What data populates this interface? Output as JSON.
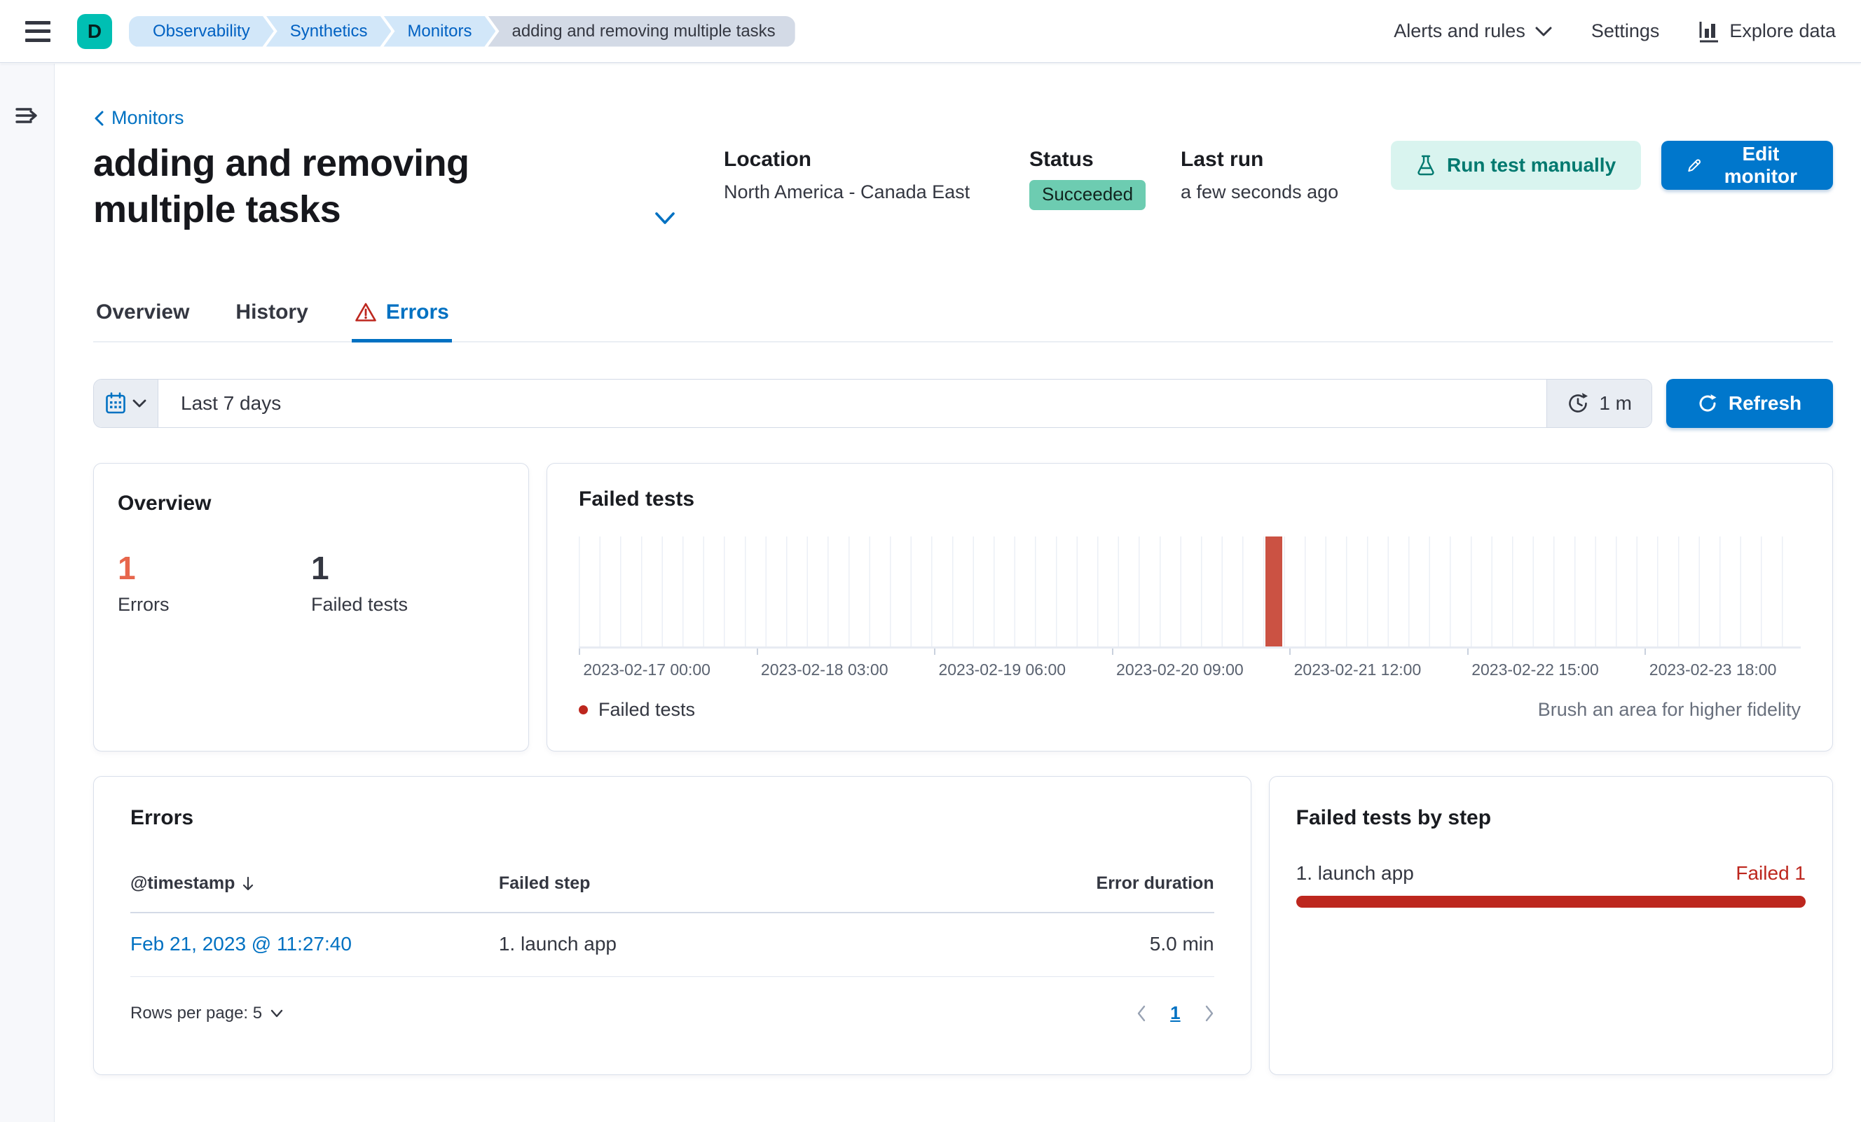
{
  "top_nav": {
    "logo_letter": "D",
    "breadcrumbs": [
      {
        "label": "Observability"
      },
      {
        "label": "Synthetics"
      },
      {
        "label": "Monitors"
      },
      {
        "label": "adding and removing multiple tasks"
      }
    ],
    "alerts_menu_label": "Alerts and rules",
    "settings_label": "Settings",
    "explore_data_label": "Explore data"
  },
  "header": {
    "back_link": "Monitors",
    "title": "adding and removing multiple tasks",
    "location_label": "Location",
    "location_value": "North America - Canada East",
    "status_label": "Status",
    "status_value": "Succeeded",
    "last_run_label": "Last run",
    "last_run_value": "a few seconds ago",
    "run_test_button": "Run test manually",
    "edit_button": "Edit monitor"
  },
  "tabs": [
    {
      "label": "Overview"
    },
    {
      "label": "History"
    },
    {
      "label": "Errors",
      "active": true
    }
  ],
  "toolbar": {
    "time_range": "Last 7 days",
    "refresh_interval": "1 m",
    "refresh_label": "Refresh"
  },
  "overview_panel": {
    "title": "Overview",
    "stats": [
      {
        "value": "1",
        "label": "Errors",
        "color": "#E7664C"
      },
      {
        "value": "1",
        "label": "Failed tests",
        "color": "#343741"
      }
    ]
  },
  "failed_tests_panel": {
    "title": "Failed tests",
    "legend": "Failed tests",
    "note": "Brush an area for higher fidelity"
  },
  "chart_data": {
    "type": "bar",
    "title": "Failed tests",
    "x_ticks": [
      "2023-02-17 00:00",
      "2023-02-18 03:00",
      "2023-02-19 06:00",
      "2023-02-20 09:00",
      "2023-02-21 12:00",
      "2023-02-22 15:00",
      "2023-02-23 18:00"
    ],
    "x_range": [
      "2023-02-16 21:00",
      "2023-02-23 21:00"
    ],
    "ylim": [
      0,
      1
    ],
    "grid": "vertical-only",
    "legend_position": "bottom-left",
    "series": [
      {
        "name": "Failed tests",
        "color": "#CB5243",
        "points": [
          {
            "x": "2023-02-21 11:27",
            "y": 1
          }
        ]
      }
    ],
    "annotation": "Brush an area for higher fidelity"
  },
  "errors_panel": {
    "title": "Errors",
    "columns": {
      "timestamp": "@timestamp",
      "failed_step": "Failed step",
      "error_duration": "Error duration"
    },
    "rows": [
      {
        "timestamp": "Feb 21, 2023 @ 11:27:40",
        "failed_step": "1. launch app",
        "error_duration": "5.0 min"
      }
    ],
    "rows_per_page_label": "Rows per page: 5",
    "current_page": "1"
  },
  "failed_steps_panel": {
    "title": "Failed tests by step",
    "steps": [
      {
        "label": "1. launch app",
        "status": "Failed 1",
        "percent": 100
      }
    ]
  },
  "colors": {
    "primary_blue": "#0077CC",
    "link_blue": "#0071C2",
    "success_badge": "#6DCCB1",
    "danger_red": "#BD271E",
    "chart_bar_red": "#CB5243",
    "stat_error_red": "#E7664C",
    "brand_teal": "#00BFB3"
  }
}
